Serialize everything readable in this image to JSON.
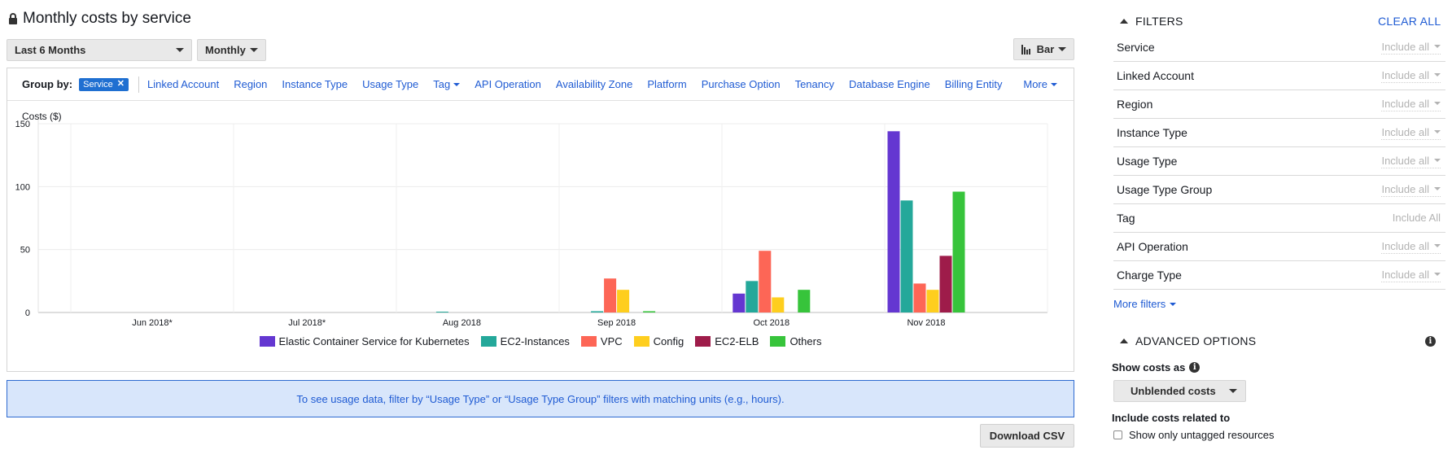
{
  "header": {
    "title": "Monthly costs by service"
  },
  "controls": {
    "time_range": "Last 6 Months",
    "granularity": "Monthly",
    "chart_style": "Bar"
  },
  "group_by": {
    "label": "Group by:",
    "active_chip": "Service",
    "options": [
      "Linked Account",
      "Region",
      "Instance Type",
      "Usage Type",
      "Tag",
      "API Operation",
      "Availability Zone",
      "Platform",
      "Purchase Option",
      "Tenancy",
      "Database Engine",
      "Billing Entity"
    ],
    "more": "More"
  },
  "chart_data": {
    "type": "bar",
    "ylabel": "Costs ($)",
    "ylim": [
      0,
      150
    ],
    "yticks": [
      "0",
      "50",
      "100",
      "150"
    ],
    "categories": [
      "Jun 2018*",
      "Jul 2018*",
      "Aug 2018",
      "Sep 2018",
      "Oct 2018",
      "Nov 2018"
    ],
    "series": [
      {
        "name": "Elastic Container Service for Kubernetes",
        "color": "#6437d1",
        "values": [
          0,
          0,
          0,
          0,
          15,
          144
        ]
      },
      {
        "name": "EC2-Instances",
        "color": "#24a89a",
        "values": [
          0,
          0,
          0.3,
          1,
          25,
          89
        ]
      },
      {
        "name": "VPC",
        "color": "#fd6656",
        "values": [
          0,
          0,
          0,
          27,
          49,
          23
        ]
      },
      {
        "name": "Config",
        "color": "#fece1e",
        "values": [
          0,
          0,
          0,
          18,
          12,
          18
        ]
      },
      {
        "name": "EC2-ELB",
        "color": "#9e1c4a",
        "values": [
          0,
          0,
          0,
          0,
          0,
          45
        ]
      },
      {
        "name": "Others",
        "color": "#37c43b",
        "values": [
          0,
          0,
          0,
          1,
          18,
          96
        ]
      }
    ],
    "grid": true,
    "legend": "bottom"
  },
  "banner": {
    "text": "To see usage data, filter by “Usage Type” or “Usage Type Group” filters with matching units (e.g., hours)."
  },
  "download_button": "Download CSV",
  "filters": {
    "title": "FILTERS",
    "clear_all": "CLEAR ALL",
    "rows": [
      {
        "label": "Service",
        "value": "Include all"
      },
      {
        "label": "Linked Account",
        "value": "Include all"
      },
      {
        "label": "Region",
        "value": "Include all"
      },
      {
        "label": "Instance Type",
        "value": "Include all"
      },
      {
        "label": "Usage Type",
        "value": "Include all"
      },
      {
        "label": "Usage Type Group",
        "value": "Include all"
      },
      {
        "label": "Tag",
        "value": "Include All"
      },
      {
        "label": "API Operation",
        "value": "Include all"
      },
      {
        "label": "Charge Type",
        "value": "Include all"
      }
    ],
    "more_filters": "More filters"
  },
  "advanced": {
    "title": "ADVANCED OPTIONS",
    "show_costs_as_label": "Show costs as",
    "show_costs_as_value": "Unblended costs",
    "include_costs_label": "Include costs related to",
    "untagged_label": "Show only untagged resources"
  }
}
